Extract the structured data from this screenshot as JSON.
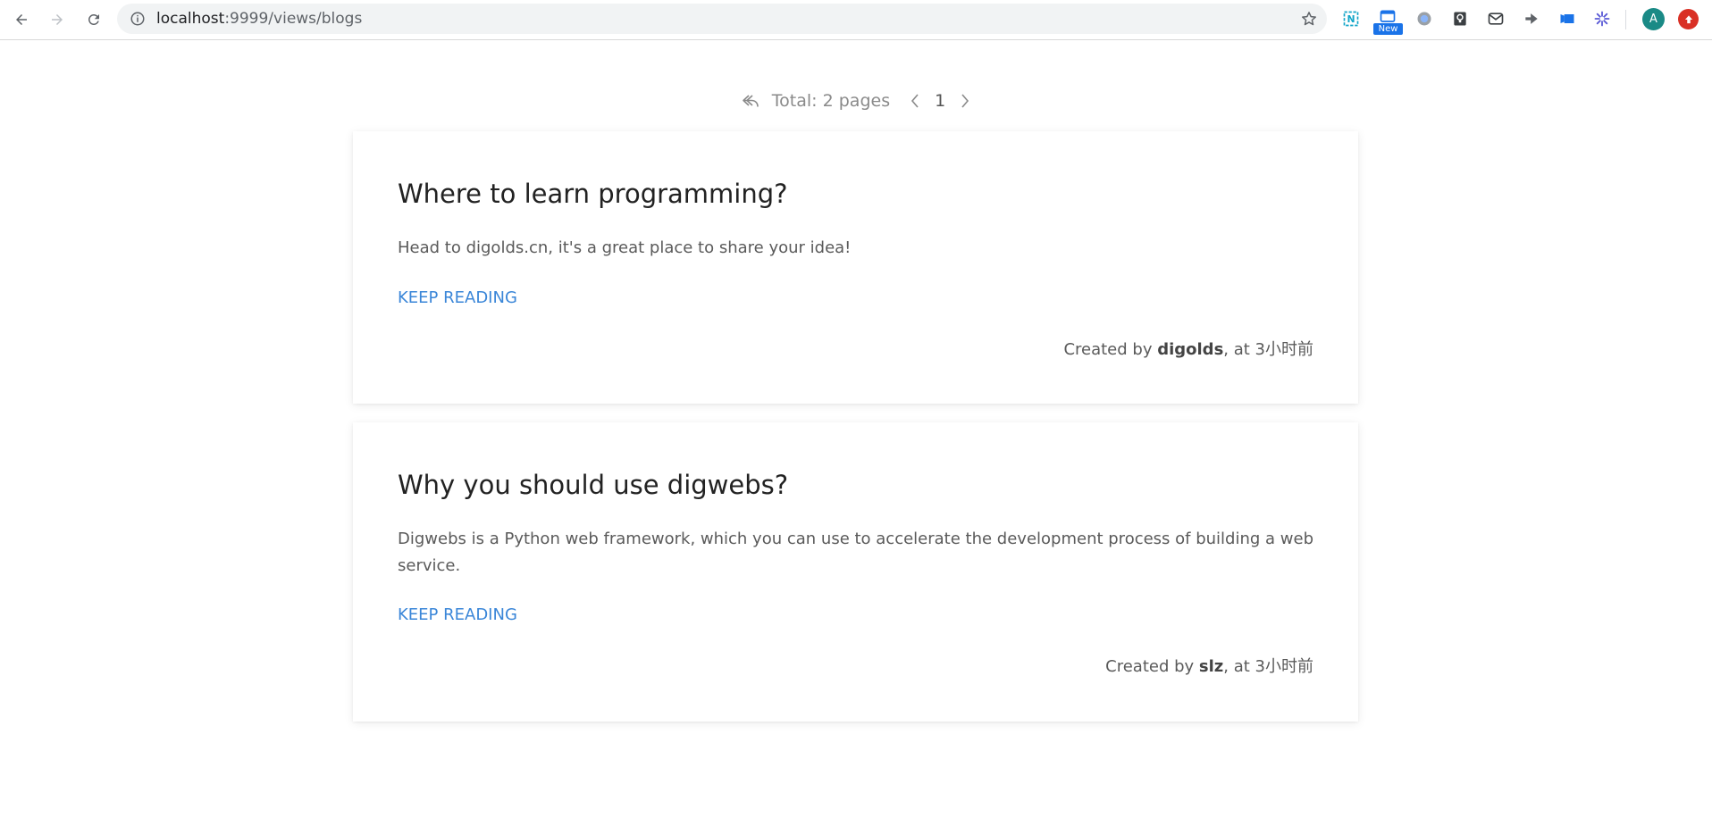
{
  "browser": {
    "url_host": "localhost",
    "url_path": ":9999/views/blogs",
    "new_badge": "New",
    "profile_initial": "A",
    "extensions": [
      "note-icon",
      "tab-icon",
      "circle-extension-icon",
      "keep-icon",
      "mail-icon",
      "arrow-extension-icon",
      "flag-extension-icon",
      "asterisk-extension-icon"
    ]
  },
  "pager": {
    "total_label": "Total: 2 pages",
    "current_page": "1"
  },
  "posts": [
    {
      "title": "Where to learn programming?",
      "summary": "Head to digolds.cn, it's a great place to share your idea!",
      "keep_reading": "KEEP READING",
      "created_prefix": "Created by ",
      "author": "digolds",
      "created_suffix": ", at 3小时前"
    },
    {
      "title": "Why you should use digwebs?",
      "summary": "Digwebs is a Python web framework, which you can use to accelerate the development process of building a web service.",
      "keep_reading": "KEEP READING",
      "created_prefix": "Created by ",
      "author": "slz",
      "created_suffix": ", at 3小时前"
    }
  ],
  "colors": {
    "link": "#3a86d8",
    "profile": "#1a8a86",
    "update": "#d93025"
  }
}
